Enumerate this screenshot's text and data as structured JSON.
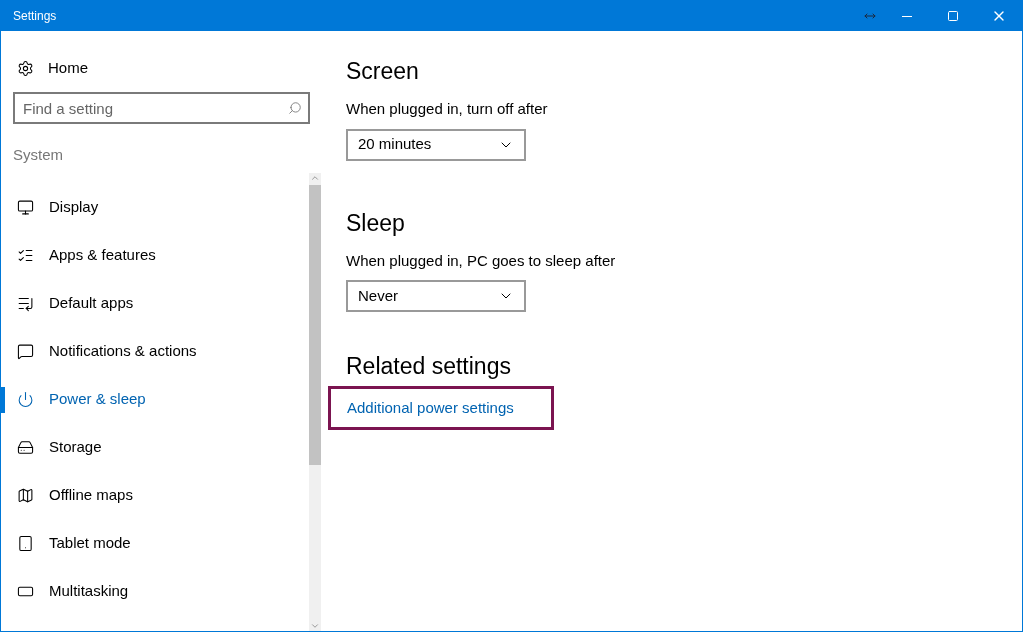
{
  "window": {
    "title": "Settings"
  },
  "sidebar": {
    "home": "Home",
    "search": {
      "placeholder": "Find a setting"
    },
    "section": "System",
    "items": [
      {
        "label": "Display",
        "selected": false
      },
      {
        "label": "Apps & features",
        "selected": false
      },
      {
        "label": "Default apps",
        "selected": false
      },
      {
        "label": "Notifications & actions",
        "selected": false
      },
      {
        "label": "Power & sleep",
        "selected": true
      },
      {
        "label": "Storage",
        "selected": false
      },
      {
        "label": "Offline maps",
        "selected": false
      },
      {
        "label": "Tablet mode",
        "selected": false
      },
      {
        "label": "Multitasking",
        "selected": false
      }
    ]
  },
  "sections": [
    {
      "heading": "Screen",
      "label": "When plugged in, turn off after",
      "value": "20 minutes"
    },
    {
      "heading": "Sleep",
      "label": "When plugged in, PC goes to sleep after",
      "value": "Never"
    }
  ],
  "related": {
    "heading": "Related settings",
    "link": "Additional power settings",
    "highlighted": true
  }
}
